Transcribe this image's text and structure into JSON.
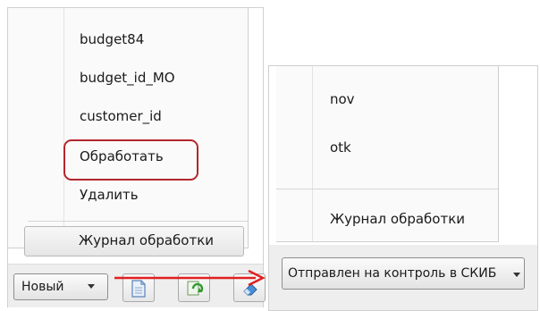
{
  "left_menu": {
    "items": [
      {
        "label": "budget84"
      },
      {
        "label": "budget_id_MO"
      },
      {
        "label": "customer_id"
      },
      {
        "label": "Обработать"
      },
      {
        "label": "Удалить"
      }
    ],
    "journal_label": "Журнал обработки"
  },
  "left_toolbar": {
    "new_label": "Новый",
    "icons": [
      "document-icon",
      "refresh-icon",
      "eraser-icon"
    ]
  },
  "right_menu": {
    "items": [
      {
        "label": "nov"
      },
      {
        "label": "otk"
      }
    ],
    "journal_label": "Журнал обработки"
  },
  "right_toolbar": {
    "status_label": "Отправлен на контроль в СКИБ"
  },
  "colors": {
    "highlight": "#b3262c",
    "arrow": "#e02020"
  }
}
